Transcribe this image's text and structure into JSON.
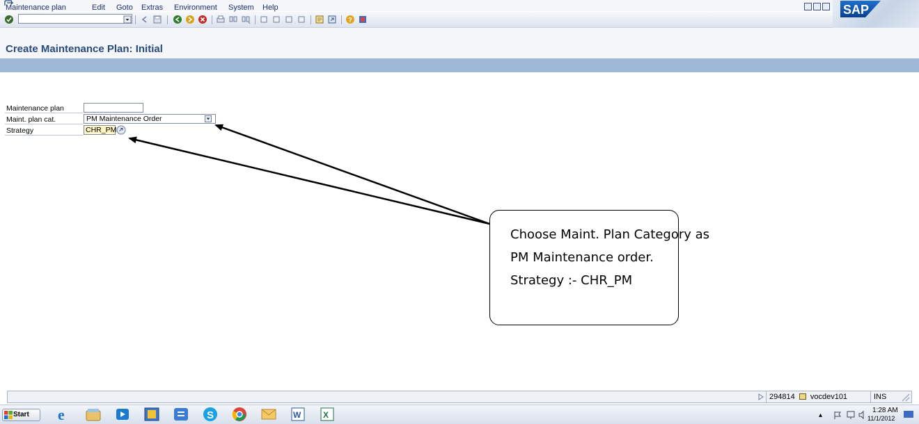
{
  "menu": {
    "items": [
      "Maintenance plan",
      "Edit",
      "Goto",
      "Extras",
      "Environment",
      "System",
      "Help"
    ]
  },
  "logo": {
    "text": "SAP"
  },
  "toolbar": {
    "command_value": "",
    "icons": [
      "enter-check-icon",
      "command-dropdown-icon",
      "back-arrow-icon",
      "save-icon",
      "back-icon",
      "exit-icon",
      "cancel-icon",
      "print-icon",
      "find-icon",
      "find-next-icon",
      "first-page-icon",
      "previous-page-icon",
      "next-page-icon",
      "last-page-icon",
      "create-session-icon",
      "shortcut-icon",
      "help-icon",
      "layout-icon"
    ]
  },
  "page": {
    "title": "Create Maintenance Plan: Initial"
  },
  "form": {
    "plan_label": "Maintenance plan",
    "plan_value": "",
    "category_label": "Maint. plan cat.",
    "category_value": "PM Maintenance Order",
    "strategy_label": "Strategy",
    "strategy_value": "CHR_PM"
  },
  "callout": {
    "lines": [
      "Choose Maint. Plan Category as",
      "PM Maintenance order.",
      "Strategy :- CHR_PM"
    ]
  },
  "status": {
    "session_number": "294814",
    "server": "vocdev101",
    "mode": "INS"
  },
  "taskbar": {
    "start": "Start",
    "time": "1:28 AM",
    "date": "11/1/2012",
    "apps": [
      "internet-explorer-icon",
      "file-explorer-icon",
      "media-player-icon",
      "paint-icon",
      "network-icon",
      "skype-icon",
      "chrome-icon",
      "outlook-icon",
      "word-icon",
      "excel-icon"
    ]
  },
  "colors": {
    "title": "#2a4a7c",
    "app_toolbar": "#9fb8d8",
    "menu_text": "#1c2f6a",
    "required_field": "#fff6c2"
  }
}
